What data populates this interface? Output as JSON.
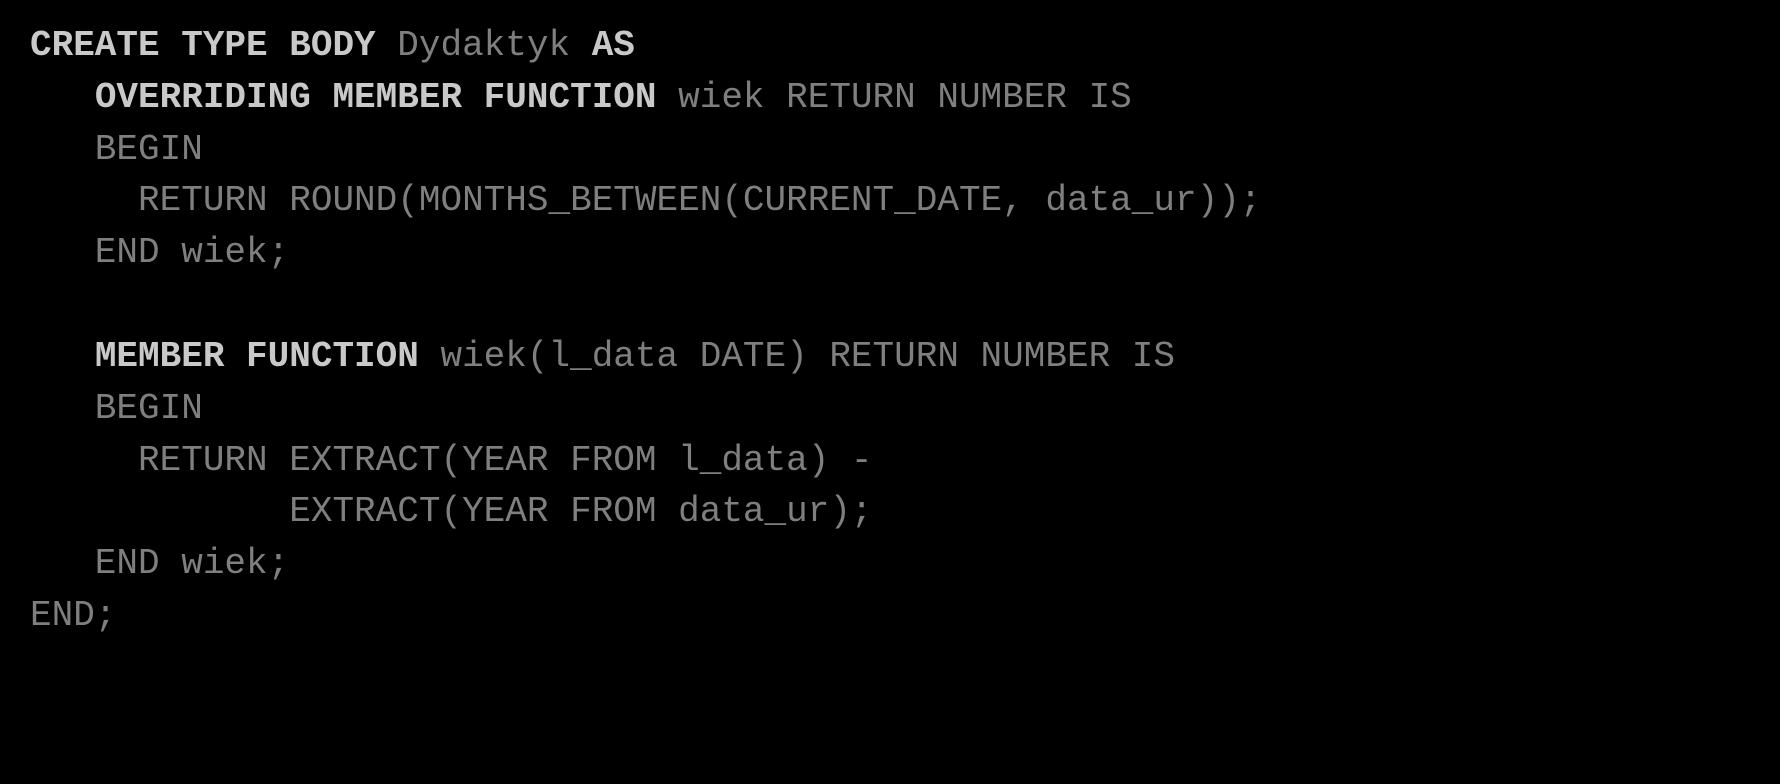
{
  "code": {
    "tokens": [
      {
        "t": "CREATE TYPE BODY ",
        "k": true
      },
      {
        "t": "Dydaktyk ",
        "k": false
      },
      {
        "t": "AS",
        "k": true
      },
      {
        "t": "\n",
        "k": false
      },
      {
        "t": "   ",
        "k": false
      },
      {
        "t": "OVERRIDING MEMBER FUNCTION ",
        "k": true
      },
      {
        "t": "wiek RETURN NUMBER IS\n",
        "k": false
      },
      {
        "t": "   BEGIN\n",
        "k": false
      },
      {
        "t": "     RETURN ROUND(MONTHS_BETWEEN(CURRENT_DATE, data_ur));\n",
        "k": false
      },
      {
        "t": "   END wiek;\n",
        "k": false
      },
      {
        "t": "\n",
        "k": false
      },
      {
        "t": "   ",
        "k": false
      },
      {
        "t": "MEMBER FUNCTION ",
        "k": true
      },
      {
        "t": "wiek(l_data DATE) RETURN NUMBER IS\n",
        "k": false
      },
      {
        "t": "   BEGIN\n",
        "k": false
      },
      {
        "t": "     RETURN EXTRACT(YEAR FROM l_data) -\n",
        "k": false
      },
      {
        "t": "            EXTRACT(YEAR FROM data_ur);\n",
        "k": false
      },
      {
        "t": "   END wiek;\n",
        "k": false
      },
      {
        "t": "END;",
        "k": false
      }
    ]
  }
}
